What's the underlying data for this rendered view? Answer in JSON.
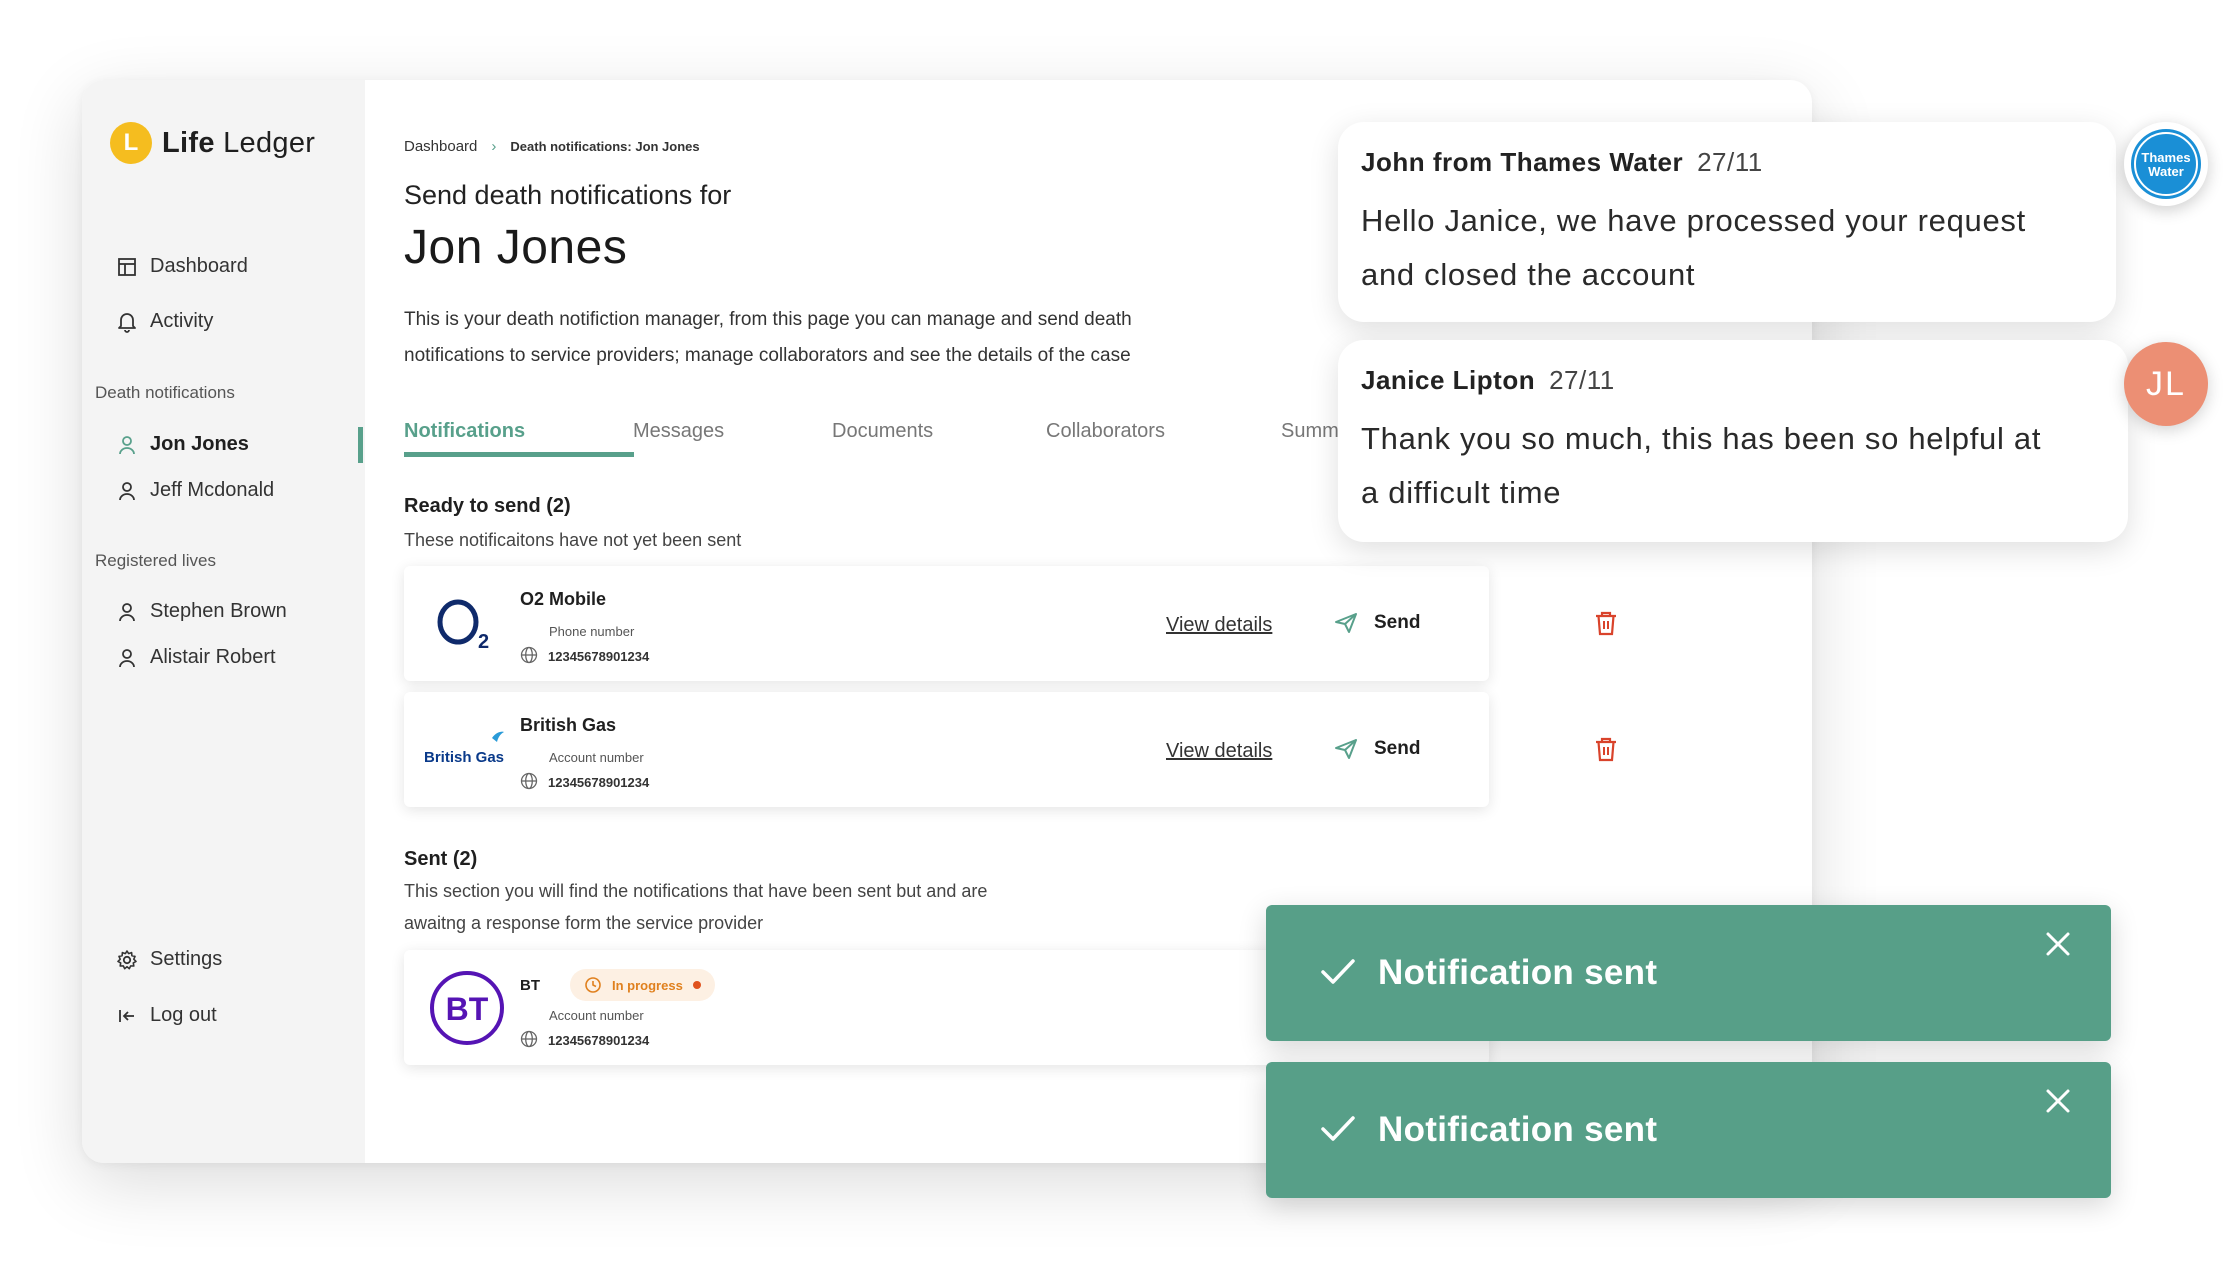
{
  "app": {
    "logo_text_bold": "Life",
    "logo_text_regular": " Ledger",
    "logo_letter": "L"
  },
  "sidebar": {
    "nav": [
      {
        "label": "Dashboard",
        "icon": "dashboard-icon"
      },
      {
        "label": "Activity",
        "icon": "bell-icon"
      }
    ],
    "death_notifications_heading": "Death notifications",
    "death_notifications": [
      {
        "label": "Jon Jones",
        "active": true
      },
      {
        "label": "Jeff Mcdonald",
        "active": false
      }
    ],
    "registered_lives_heading": "Registered lives",
    "registered_lives": [
      {
        "label": "Stephen Brown"
      },
      {
        "label": "Alistair Robert"
      }
    ],
    "settings_label": "Settings",
    "logout_label": "Log out"
  },
  "breadcrumb": {
    "root": "Dashboard",
    "current": "Death notifications: Jon Jones"
  },
  "header": {
    "subtitle": "Send death notifications for",
    "title": "Jon Jones",
    "description_line1": "This is your death notifiction manager, from this page you can manage and send death",
    "description_line2": "notifications to service providers; manage collaborators and see the details of the case"
  },
  "tabs": [
    {
      "label": "Notifications",
      "active": true
    },
    {
      "label": "Messages",
      "active": false
    },
    {
      "label": "Documents",
      "active": false
    },
    {
      "label": "Collaborators",
      "active": false
    },
    {
      "label": "Summ",
      "active": false
    }
  ],
  "ready": {
    "title": "Ready to send (2)",
    "subtitle": "These notificaitons have not yet been sent",
    "items": [
      {
        "name": "O2 Mobile",
        "logo": "O2",
        "field_label": "Phone number",
        "field_value": "12345678901234",
        "view_label": "View details",
        "send_label": "Send"
      },
      {
        "name": "British Gas",
        "logo": "British Gas",
        "field_label": "Account number",
        "field_value": "12345678901234",
        "view_label": "View details",
        "send_label": "Send"
      }
    ]
  },
  "sent": {
    "title": "Sent (2)",
    "subtitle_line1": "This section you will find the notifications that have been sent but and are",
    "subtitle_line2": "awaitng a response form the service provider",
    "items": [
      {
        "name": "BT",
        "logo": "BT",
        "status": "In progress",
        "field_label": "Account number",
        "field_value": "12345678901234"
      }
    ]
  },
  "messages": [
    {
      "author": "John from Thames Water",
      "date": "27/11",
      "line1": "Hello Janice, we have processed your request",
      "line2": "and closed the account",
      "avatar_text": "Thames Water"
    },
    {
      "author": "Janice Lipton",
      "date": "27/11",
      "line1": "Thank you so much, this has been so helpful at",
      "line2": "a difficult time",
      "avatar_text": "JL"
    }
  ],
  "toasts": [
    {
      "text": "Notification sent"
    },
    {
      "text": "Notification sent"
    }
  ],
  "colors": {
    "accent": "#58a08b",
    "toast": "#579f88",
    "danger": "#d9432b",
    "logo_yellow": "#f5bd1f",
    "o2_blue": "#0f2a6b",
    "bt_purple": "#5514b4",
    "badge_orange": "#e0801e",
    "avatar_jl": "#ec8f74"
  }
}
